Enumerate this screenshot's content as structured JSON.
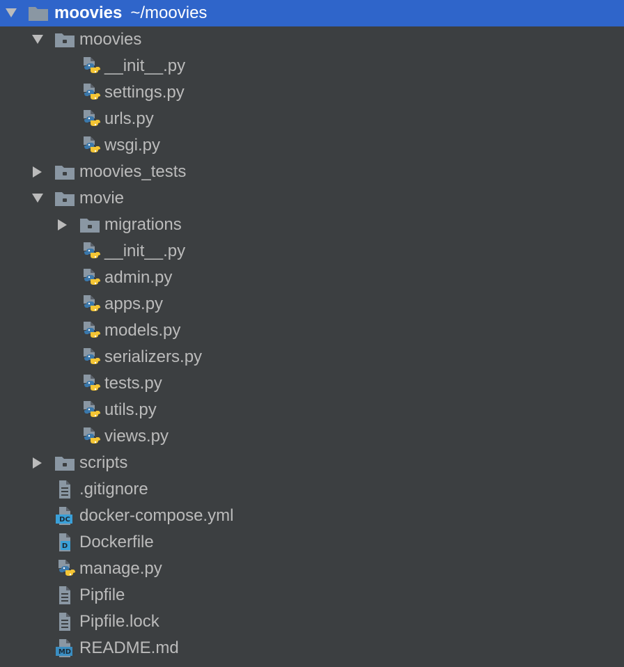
{
  "project": {
    "root_name": "moovies",
    "root_path": "~/moovies"
  },
  "tree": [
    {
      "label": "moovies",
      "kind": "folder",
      "state": "expanded",
      "icon": "package-folder-icon"
    },
    {
      "label": "__init__.py",
      "kind": "python-file",
      "icon": "python-file-icon"
    },
    {
      "label": "settings.py",
      "kind": "python-file",
      "icon": "python-file-icon"
    },
    {
      "label": "urls.py",
      "kind": "python-file",
      "icon": "python-file-icon"
    },
    {
      "label": "wsgi.py",
      "kind": "python-file",
      "icon": "python-file-icon"
    },
    {
      "label": "moovies_tests",
      "kind": "folder",
      "state": "collapsed",
      "icon": "package-folder-icon"
    },
    {
      "label": "movie",
      "kind": "folder",
      "state": "expanded",
      "icon": "package-folder-icon"
    },
    {
      "label": "migrations",
      "kind": "folder",
      "state": "collapsed",
      "icon": "package-folder-icon"
    },
    {
      "label": "__init__.py",
      "kind": "python-file",
      "icon": "python-file-icon"
    },
    {
      "label": "admin.py",
      "kind": "python-file",
      "icon": "python-file-icon"
    },
    {
      "label": "apps.py",
      "kind": "python-file",
      "icon": "python-file-icon"
    },
    {
      "label": "models.py",
      "kind": "python-file",
      "icon": "python-file-icon"
    },
    {
      "label": "serializers.py",
      "kind": "python-file",
      "icon": "python-file-icon"
    },
    {
      "label": "tests.py",
      "kind": "python-file",
      "icon": "python-file-icon"
    },
    {
      "label": "utils.py",
      "kind": "python-file",
      "icon": "python-file-icon"
    },
    {
      "label": "views.py",
      "kind": "python-file",
      "icon": "python-file-icon"
    },
    {
      "label": "scripts",
      "kind": "folder",
      "state": "collapsed",
      "icon": "package-folder-icon"
    },
    {
      "label": ".gitignore",
      "kind": "text-file",
      "icon": "text-file-icon"
    },
    {
      "label": "docker-compose.yml",
      "kind": "docker-compose-file",
      "icon": "docker-compose-file-icon",
      "badge": "DC"
    },
    {
      "label": "Dockerfile",
      "kind": "dockerfile",
      "icon": "dockerfile-icon",
      "badge": "D"
    },
    {
      "label": "manage.py",
      "kind": "python-file",
      "icon": "python-file-icon"
    },
    {
      "label": "Pipfile",
      "kind": "text-file",
      "icon": "text-file-icon"
    },
    {
      "label": "Pipfile.lock",
      "kind": "text-file",
      "icon": "text-file-icon"
    },
    {
      "label": "README.md",
      "kind": "markdown-file",
      "icon": "markdown-file-icon",
      "badge": "MD"
    }
  ],
  "colors": {
    "background": "#3c3f41",
    "selection": "#2f65ca",
    "text": "#bbbbbb",
    "folder": "#a9b7c6",
    "python_blue": "#3b78ab",
    "python_yellow": "#f4c534",
    "docker_blue": "#3aa0d8",
    "markdown_blue": "#3a8ec2"
  }
}
